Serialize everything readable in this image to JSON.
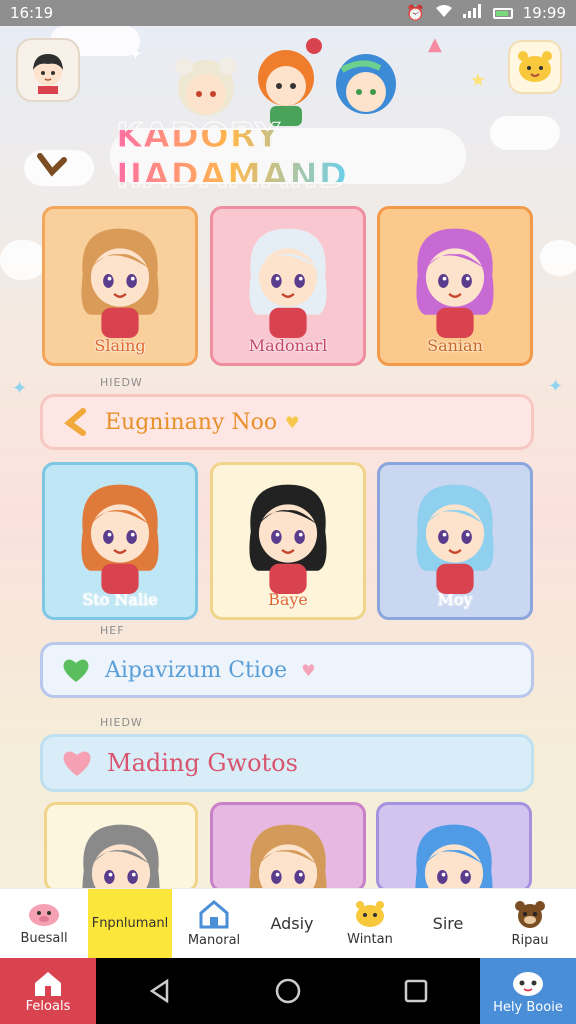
{
  "status_bar": {
    "time": "16:19",
    "clock_right": "19:99"
  },
  "header": {
    "logo_text": "KADORY IIADAMAND"
  },
  "top_cards": [
    {
      "label": "Slaing",
      "bg": "#f9cf9c",
      "border": "#f3a65a",
      "hair": "#d99b57",
      "label_color": "#e0672d"
    },
    {
      "label": "Madonarl",
      "bg": "#f8c7cf",
      "border": "#ee8ea0",
      "hair": "#e4eef4",
      "label_color": "#c4456a"
    },
    {
      "label": "Sanian",
      "bg": "#fbc98c",
      "border": "#f29a4a",
      "hair": "#c86ad4",
      "label_color": "#c96820"
    }
  ],
  "sections": {
    "label_1": "HIEDW",
    "banner_1": "Eugninany Noo",
    "label_2": "HEF",
    "banner_2": "Aipavizum Ctioe",
    "label_3": "HIEDW",
    "banner_3": "Mading Gwotos"
  },
  "mid_cards": [
    {
      "label": "Sto Nalie",
      "bg": "#bfe6f4",
      "border": "#7cc7e3",
      "hair": "#e07a3a",
      "label_color": "#ffffff"
    },
    {
      "label": "Baye",
      "bg": "#fdf4d9",
      "border": "#f0d48a",
      "hair": "#222222",
      "label_color": "#e0672d"
    },
    {
      "label": "Moy",
      "bg": "#c9d7f0",
      "border": "#8ba6dc",
      "hair": "#8fd0ee",
      "label_color": "#ffffff"
    }
  ],
  "bottom_cards": [
    {
      "bg": "#fdf6df",
      "border": "#f0d48a",
      "hair": "#8a8a8a"
    },
    {
      "bg": "#e6b8e2",
      "border": "#c880c8",
      "hair": "#d49a5a"
    },
    {
      "bg": "#d3c4ef",
      "border": "#a592de",
      "hair": "#4f9be6"
    }
  ],
  "bottom_tabs": [
    {
      "label": "Buesall"
    },
    {
      "label": "Fnpnlumanl"
    },
    {
      "label": "Manoral"
    },
    {
      "label": "Adsiy"
    },
    {
      "label": "Wintan"
    },
    {
      "label": "Sire"
    },
    {
      "label": "Ripau"
    }
  ],
  "system_nav": {
    "left_label": "Feloals",
    "right_label": "Hely Booie"
  },
  "icons": {
    "avatar": "boy-avatar-icon",
    "mascot": "yellow-mascot-icon",
    "back": "chevron-left-icon",
    "home": "home-icon",
    "triangle": "back-triangle-icon",
    "circle": "home-circle-icon",
    "square": "recents-square-icon"
  }
}
